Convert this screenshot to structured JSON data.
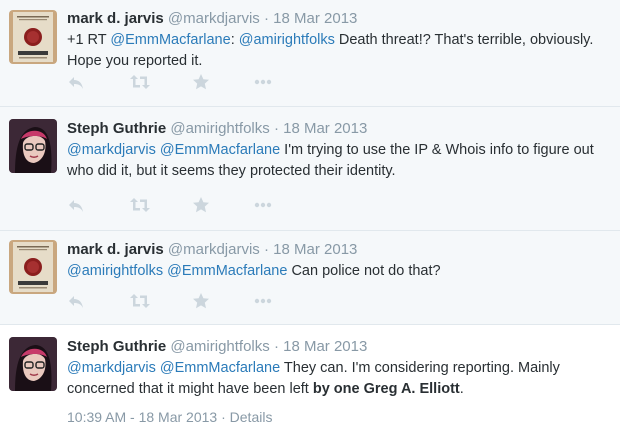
{
  "tweets": [
    {
      "fullname": "mark d. jarvis",
      "username": "@markdjarvis",
      "separator": "·",
      "time": "18 Mar 2013",
      "parts": {
        "p1": "+1 RT ",
        "m1": "@EmmMacfarlane",
        "p2": ": ",
        "m2": "@amirightfolks",
        "p3": " Death threat!? That's terrible, obviously. Hope you reported it."
      }
    },
    {
      "fullname": "Steph Guthrie",
      "username": "@amirightfolks",
      "separator": "·",
      "time": "18 Mar 2013",
      "parts": {
        "m1": "@markdjarvis",
        "p1": " ",
        "m2": "@EmmMacfarlane",
        "p2": " I'm trying to use the IP & Whois info to figure out who did it, but it seems they protected their identity."
      }
    },
    {
      "fullname": "mark d. jarvis",
      "username": "@markdjarvis",
      "separator": "·",
      "time": "18 Mar 2013",
      "parts": {
        "m1": "@amirightfolks",
        "p1": " ",
        "m2": "@EmmMacfarlane",
        "p2": " Can police not do that?"
      }
    },
    {
      "fullname": "Steph Guthrie",
      "username": "@amirightfolks",
      "separator": "·",
      "time": "18 Mar 2013",
      "parts": {
        "m1": "@markdjarvis",
        "p1": " ",
        "m2": "@EmmMacfarlane",
        "p2": " They can. I'm considering reporting. Mainly concerned that it might have been left ",
        "b1": "by one Greg A. Elliott",
        "p3": "."
      },
      "meta": {
        "timestamp": "10:39 AM - 18 Mar 2013",
        "separator": "·",
        "details": "Details"
      }
    }
  ],
  "icons": [
    "reply-icon",
    "retweet-icon",
    "favorite-icon",
    "more-icon"
  ],
  "colors": {
    "mention": "#2b7bb9",
    "muted": "#8899a6",
    "icon": "#ccd6dd",
    "background": "#f5f8fa",
    "focused_background": "#ffffff"
  }
}
